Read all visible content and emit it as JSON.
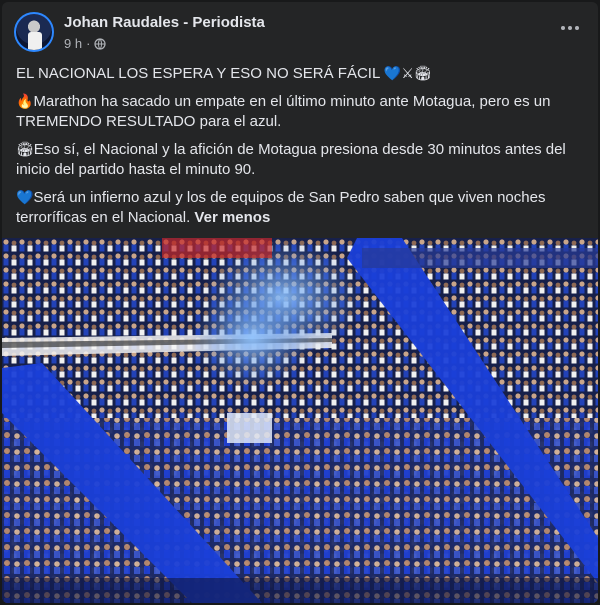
{
  "post": {
    "author": "Johan Raudales - Periodista",
    "time": "9 h",
    "separator": "·",
    "privacy_icon": "globe-icon",
    "headline": "EL NACIONAL LOS ESPERA Y ESO NO SERÁ FÁCIL",
    "headline_emojis": "💙⚔🏟",
    "paragraphs": [
      {
        "emoji": "🔥",
        "text": "Marathon ha sacado un empate en el último minuto ante Motagua, pero es un TREMENDO RESULTADO para el azul."
      },
      {
        "emoji": "🏟",
        "text": "Eso sí, el Nacional y la afición de Motagua presiona desde 30 minutos antes del inicio del partido hasta el minuto 90."
      },
      {
        "emoji": "💙",
        "text": "Será un infierno azul y los de equipos de San Pedro saben que viven noches terroríficas en el Nacional."
      }
    ],
    "see_less": "Ver menos"
  },
  "colors": {
    "background": "#18191a",
    "card": "#242526",
    "text_primary": "#e4e6eb",
    "text_secondary": "#b0b3b8",
    "flag_blue": "#1a3fd8",
    "heart_blue": "#5ab4f5"
  }
}
